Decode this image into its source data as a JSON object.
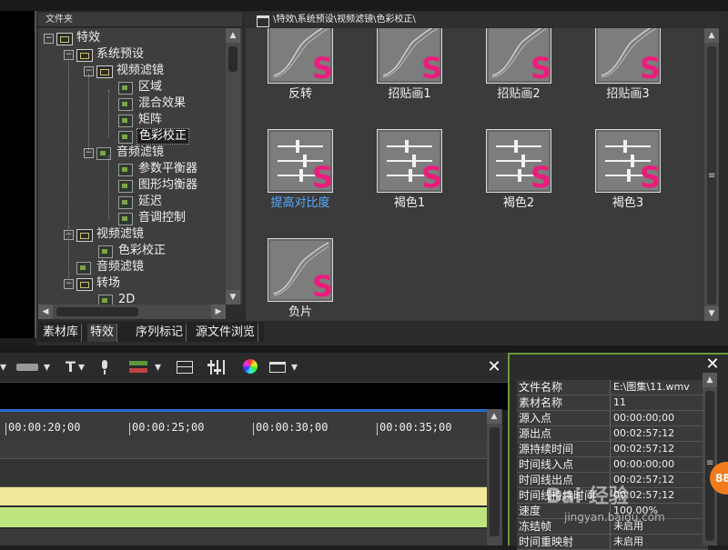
{
  "tree": {
    "header": "文件夹",
    "items": [
      {
        "label": "特效"
      },
      {
        "label": "系统预设"
      },
      {
        "label": "视频滤镜"
      },
      {
        "label": "区域"
      },
      {
        "label": "混合效果"
      },
      {
        "label": "矩阵"
      },
      {
        "label": "色彩校正"
      },
      {
        "label": "音频滤镜"
      },
      {
        "label": "参数平衡器"
      },
      {
        "label": "图形均衡器"
      },
      {
        "label": "延迟"
      },
      {
        "label": "音调控制"
      },
      {
        "label": "视频滤镜"
      },
      {
        "label": "色彩校正"
      },
      {
        "label": "音频滤镜"
      },
      {
        "label": "转场"
      },
      {
        "label": "2D"
      }
    ]
  },
  "tabs": [
    "素材库",
    "特效",
    "序列标记",
    "源文件浏览"
  ],
  "content": {
    "path": "\\特效\\系统预设\\视频滤镜\\色彩校正\\",
    "effects": [
      {
        "label": "反转",
        "icon": "curve-icon"
      },
      {
        "label": "招贴画1",
        "icon": "curve-icon"
      },
      {
        "label": "招贴画2",
        "icon": "curve-icon"
      },
      {
        "label": "招贴画3",
        "icon": "curve-icon"
      },
      {
        "label": "提高对比度",
        "icon": "slider-icon"
      },
      {
        "label": "褐色1",
        "icon": "slider-icon"
      },
      {
        "label": "褐色2",
        "icon": "slider-icon"
      },
      {
        "label": "褐色3",
        "icon": "slider-icon"
      },
      {
        "label": "负片",
        "icon": "curve-icon"
      }
    ],
    "badge_letter": "S"
  },
  "timeline": {
    "ruler": [
      "00:00:20;00",
      "00:00:25;00",
      "00:00:30;00",
      "00:00:35;00"
    ]
  },
  "properties": {
    "rows": [
      {
        "key": "文件名称",
        "value": "E:\\图集\\11.wmv"
      },
      {
        "key": "素材名称",
        "value": "11"
      },
      {
        "key": "源入点",
        "value": "00:00:00;00"
      },
      {
        "key": "源出点",
        "value": "00:02:57;12"
      },
      {
        "key": "源持续时间",
        "value": "00:02:57;12"
      },
      {
        "key": "时间线入点",
        "value": "00:00:00;00"
      },
      {
        "key": "时间线出点",
        "value": "00:02:57;12"
      },
      {
        "key": "时间线持续时间",
        "value": "00:02:57;12"
      },
      {
        "key": "速度",
        "value": "100.00%"
      },
      {
        "key": "冻结帧",
        "value": "未启用"
      },
      {
        "key": "时间重映射",
        "value": "未启用"
      }
    ]
  },
  "overlay": {
    "badge": "88",
    "watermark": "Bai 经验",
    "watermark_url": "jingyan.baidu.com"
  },
  "colors": {
    "badge_s": "#ec1c7c",
    "selected_text": "#5aa9ff",
    "timeline_blue": "#2a6ad0",
    "track_yellow": "#f3e79a",
    "track_green": "#bde47e"
  }
}
